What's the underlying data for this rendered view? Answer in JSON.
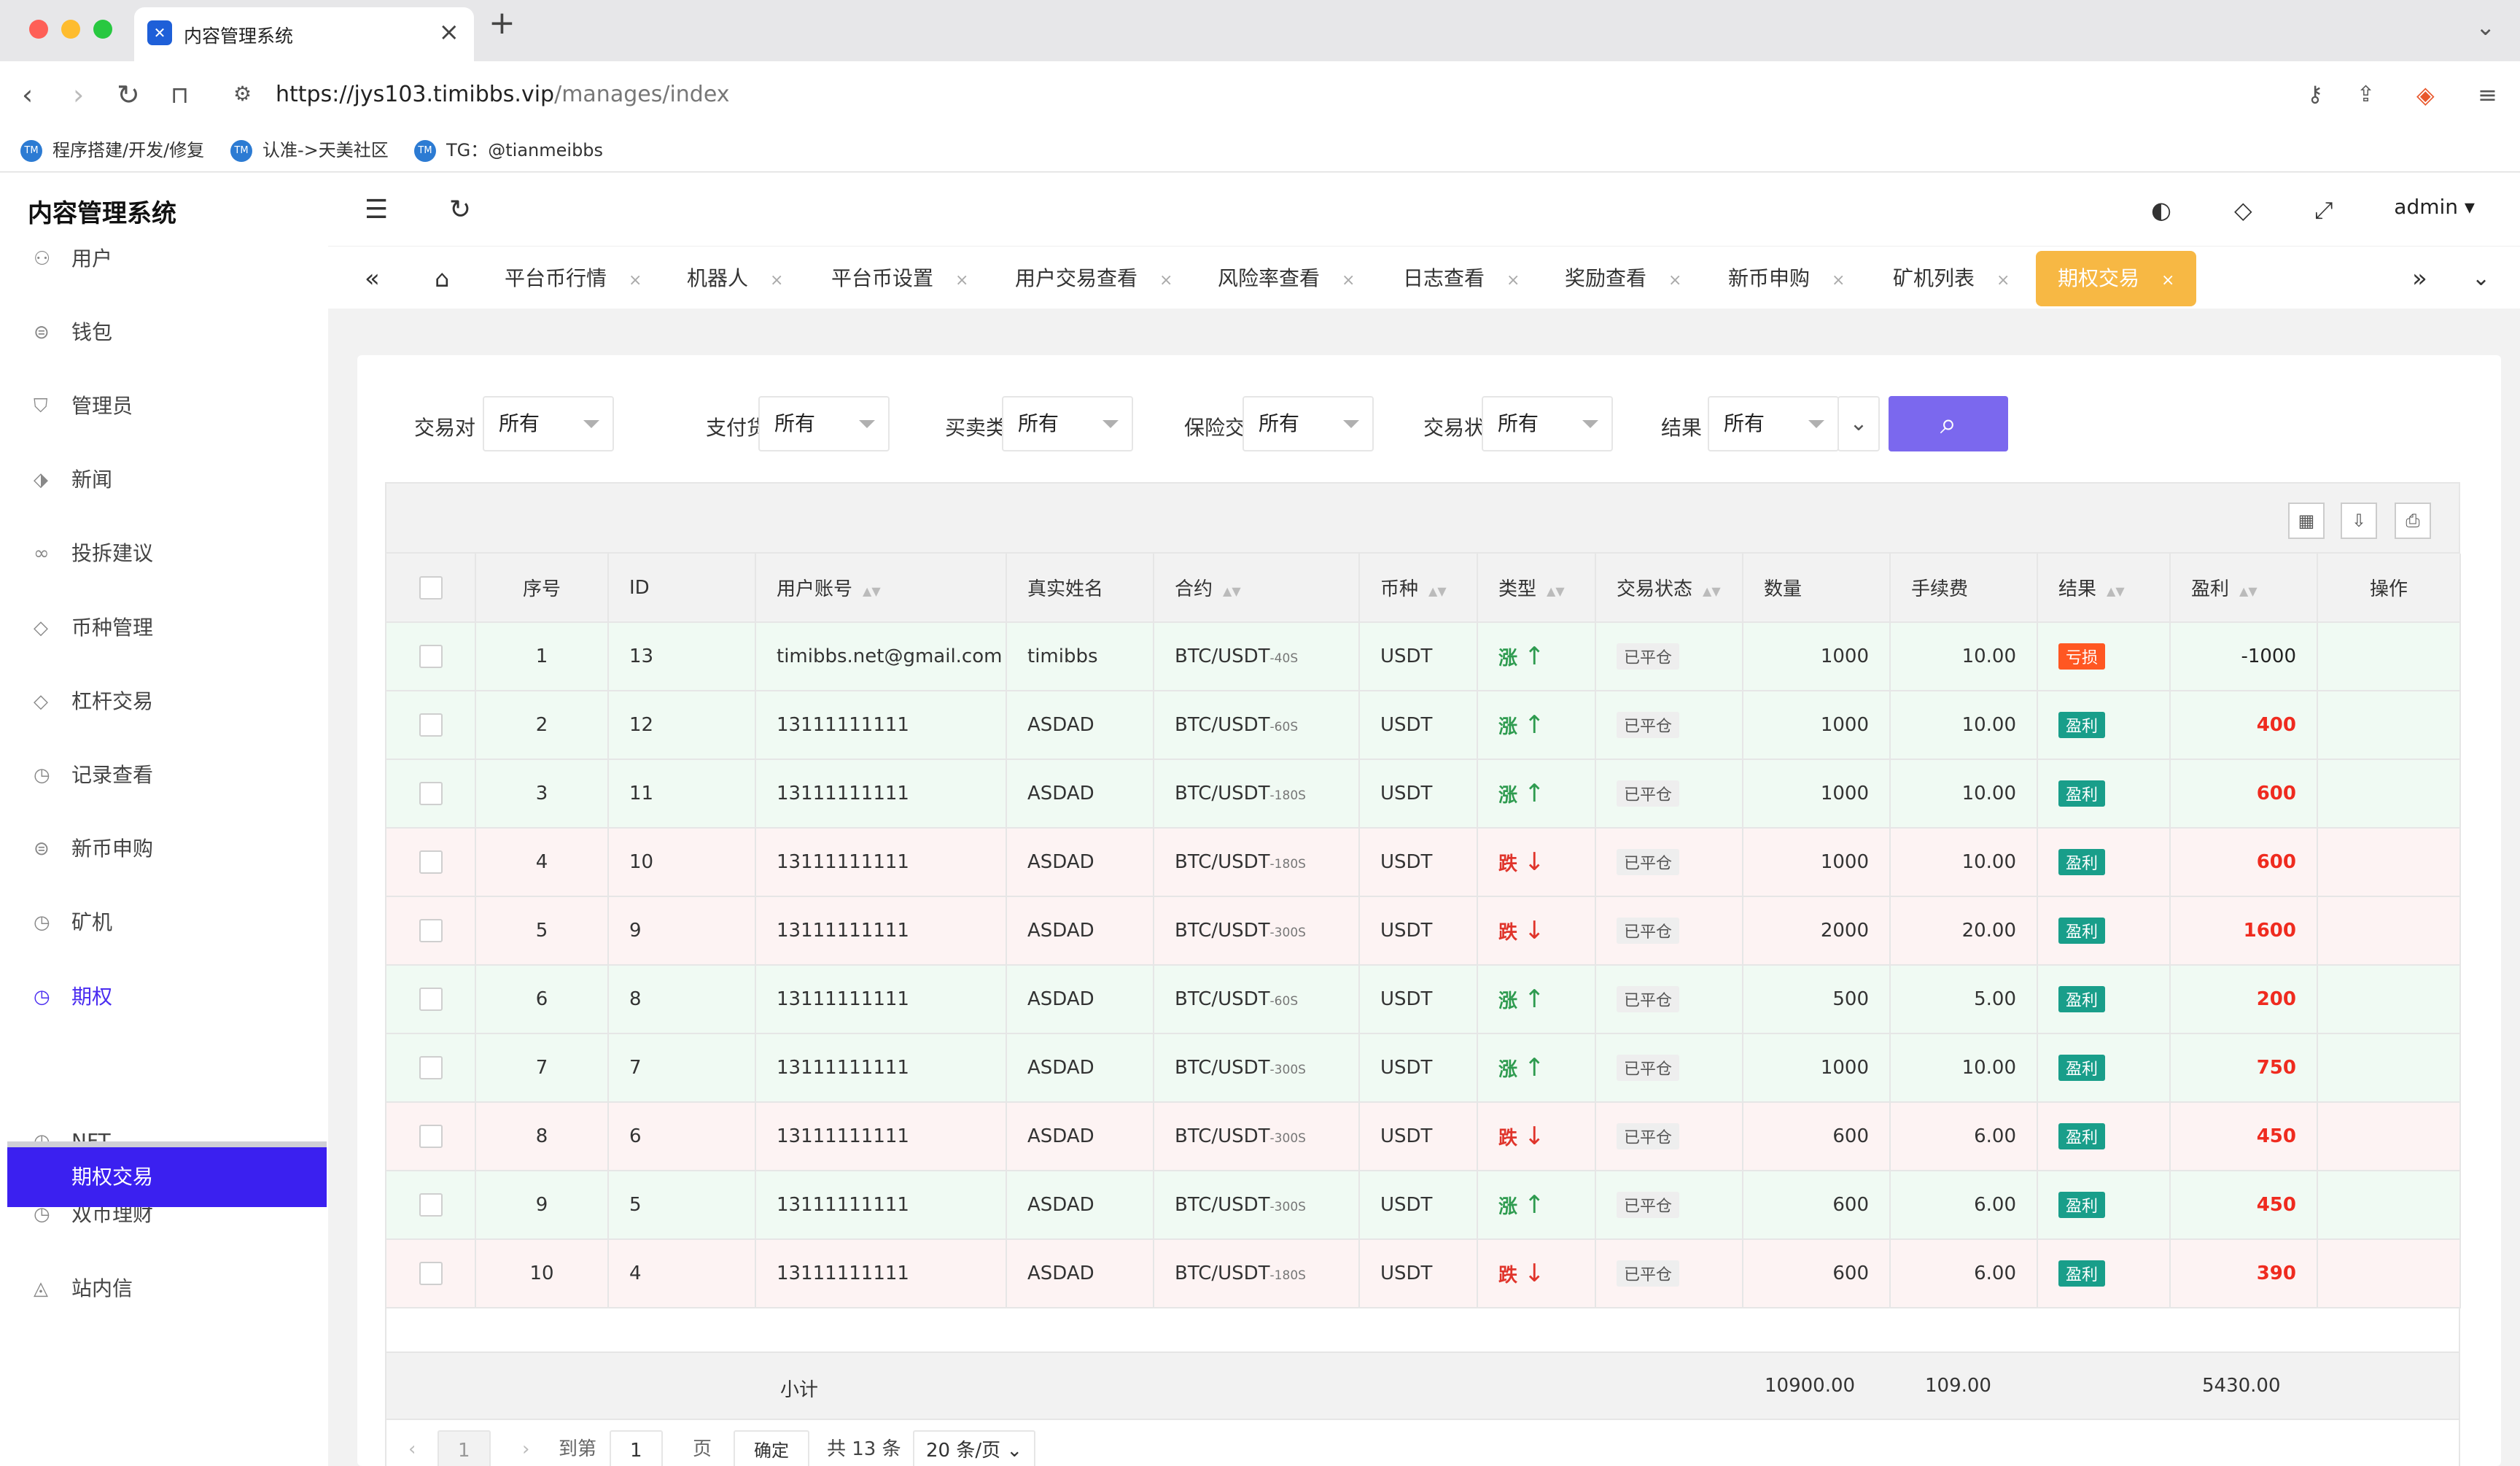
{
  "browser": {
    "tab_title": "内容管理系统",
    "url_host": "https://jys103.timibbs.vip",
    "url_path": "/manages/index",
    "bookmarks": [
      "程序搭建/开发/修复",
      "认准->天美社区",
      "TG：@tianmeibbs"
    ]
  },
  "app": {
    "brand": "内容管理系统",
    "user": "admin"
  },
  "sidebar": {
    "items": [
      {
        "label": "用户",
        "icon": "user-icon"
      },
      {
        "label": "钱包",
        "icon": "wallet-icon"
      },
      {
        "label": "管理员",
        "icon": "shield-icon"
      },
      {
        "label": "新闻",
        "icon": "tag-icon"
      },
      {
        "label": "投拆建议",
        "icon": "link-icon"
      },
      {
        "label": "币种管理",
        "icon": "diamond-icon"
      },
      {
        "label": "杠杆交易",
        "icon": "diamond-icon"
      },
      {
        "label": "记录查看",
        "icon": "clock-icon"
      },
      {
        "label": "新币申购",
        "icon": "coin-icon"
      },
      {
        "label": "矿机",
        "icon": "clock-icon"
      },
      {
        "label": "期权",
        "icon": "clock-icon"
      }
    ],
    "sub_active": "期权交易",
    "items_after": [
      {
        "label": "NFT",
        "icon": "clock-icon"
      },
      {
        "label": "双币理财",
        "icon": "clock-icon"
      },
      {
        "label": "站内信",
        "icon": "bell-icon"
      }
    ]
  },
  "page_tabs": [
    "平台币行情",
    "机器人",
    "平台币设置",
    "用户交易查看",
    "风险率查看",
    "日志查看",
    "奖励查看",
    "新币申购",
    "矿机列表",
    "期权交易"
  ],
  "filters": [
    {
      "label": "交易对",
      "value": "所有"
    },
    {
      "label": "支付货币",
      "value": "所有"
    },
    {
      "label": "买卖类型",
      "value": "所有"
    },
    {
      "label": "保险交易",
      "value": "所有"
    },
    {
      "label": "交易状态",
      "value": "所有"
    },
    {
      "label": "结果",
      "value": "所有"
    }
  ],
  "table": {
    "headers": [
      "序号",
      "ID",
      "用户账号",
      "真实姓名",
      "合约",
      "币种",
      "类型",
      "交易状态",
      "数量",
      "手续费",
      "结果",
      "盈利",
      "操作"
    ],
    "rows": [
      {
        "no": "1",
        "id": "13",
        "account": "timibbs.net@gmail.com",
        "name": "timibbs",
        "pair": "BTC/USDT",
        "period": "-40S",
        "coin": "USDT",
        "dir": "涨",
        "status": "已平仓",
        "qty": "1000",
        "fee": "10.00",
        "result": "亏损",
        "profit": "-1000"
      },
      {
        "no": "2",
        "id": "12",
        "account": "13111111111",
        "name": "ASDAD",
        "pair": "BTC/USDT",
        "period": "-60S",
        "coin": "USDT",
        "dir": "涨",
        "status": "已平仓",
        "qty": "1000",
        "fee": "10.00",
        "result": "盈利",
        "profit": "400"
      },
      {
        "no": "3",
        "id": "11",
        "account": "13111111111",
        "name": "ASDAD",
        "pair": "BTC/USDT",
        "period": "-180S",
        "coin": "USDT",
        "dir": "涨",
        "status": "已平仓",
        "qty": "1000",
        "fee": "10.00",
        "result": "盈利",
        "profit": "600"
      },
      {
        "no": "4",
        "id": "10",
        "account": "13111111111",
        "name": "ASDAD",
        "pair": "BTC/USDT",
        "period": "-180S",
        "coin": "USDT",
        "dir": "跌",
        "status": "已平仓",
        "qty": "1000",
        "fee": "10.00",
        "result": "盈利",
        "profit": "600"
      },
      {
        "no": "5",
        "id": "9",
        "account": "13111111111",
        "name": "ASDAD",
        "pair": "BTC/USDT",
        "period": "-300S",
        "coin": "USDT",
        "dir": "跌",
        "status": "已平仓",
        "qty": "2000",
        "fee": "20.00",
        "result": "盈利",
        "profit": "1600"
      },
      {
        "no": "6",
        "id": "8",
        "account": "13111111111",
        "name": "ASDAD",
        "pair": "BTC/USDT",
        "period": "-60S",
        "coin": "USDT",
        "dir": "涨",
        "status": "已平仓",
        "qty": "500",
        "fee": "5.00",
        "result": "盈利",
        "profit": "200"
      },
      {
        "no": "7",
        "id": "7",
        "account": "13111111111",
        "name": "ASDAD",
        "pair": "BTC/USDT",
        "period": "-300S",
        "coin": "USDT",
        "dir": "涨",
        "status": "已平仓",
        "qty": "1000",
        "fee": "10.00",
        "result": "盈利",
        "profit": "750"
      },
      {
        "no": "8",
        "id": "6",
        "account": "13111111111",
        "name": "ASDAD",
        "pair": "BTC/USDT",
        "period": "-300S",
        "coin": "USDT",
        "dir": "跌",
        "status": "已平仓",
        "qty": "600",
        "fee": "6.00",
        "result": "盈利",
        "profit": "450"
      },
      {
        "no": "9",
        "id": "5",
        "account": "13111111111",
        "name": "ASDAD",
        "pair": "BTC/USDT",
        "period": "-300S",
        "coin": "USDT",
        "dir": "涨",
        "status": "已平仓",
        "qty": "600",
        "fee": "6.00",
        "result": "盈利",
        "profit": "450"
      },
      {
        "no": "10",
        "id": "4",
        "account": "13111111111",
        "name": "ASDAD",
        "pair": "BTC/USDT",
        "period": "-180S",
        "coin": "USDT",
        "dir": "跌",
        "status": "已平仓",
        "qty": "600",
        "fee": "6.00",
        "result": "盈利",
        "profit": "390"
      }
    ],
    "subtotal_label": "小计",
    "subtotal_qty": "10900.00",
    "subtotal_fee": "109.00",
    "subtotal_profit": "5430.00"
  },
  "pager": {
    "current": "1",
    "goto_label": "到第",
    "goto_value": "1",
    "page_unit": "页",
    "confirm": "确定",
    "total": "共 13 条",
    "page_size": "20 条/页"
  },
  "colors": {
    "accent": "#3b20f0",
    "tab_active": "#f7b844",
    "search_button": "#7b68ee",
    "win": "#199e8a",
    "lose": "#ff5722"
  }
}
